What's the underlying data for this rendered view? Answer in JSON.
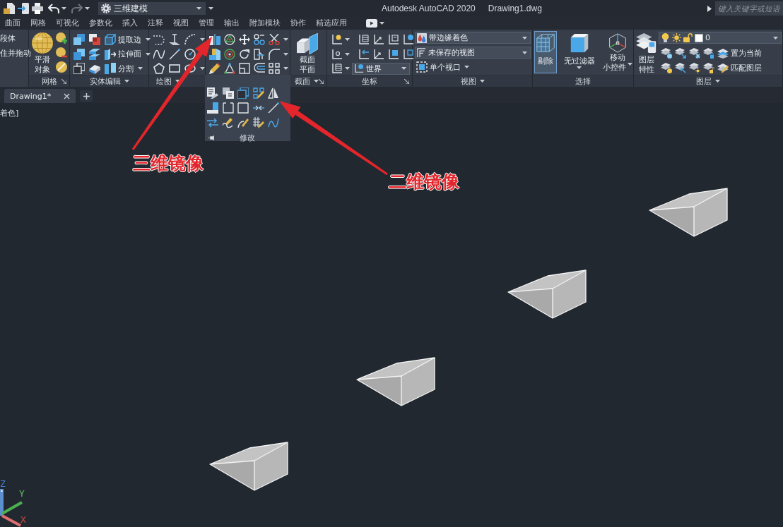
{
  "title_bar": {
    "quick_access": {
      "undo": {
        "disabled": false
      },
      "redo": {
        "disabled": true
      }
    },
    "workspace": "三维建模",
    "app_name": "Autodesk AutoCAD 2020",
    "file_name": "Drawing1.dwg",
    "search": {
      "placeholder": "键入关键字或短语"
    }
  },
  "ribbon_tabs": [
    {
      "label": "曲面",
      "selected": false
    },
    {
      "label": "网格",
      "selected": false
    },
    {
      "label": "可视化",
      "selected": false
    },
    {
      "label": "参数化",
      "selected": false
    },
    {
      "label": "插入",
      "selected": false
    },
    {
      "label": "注释",
      "selected": false
    },
    {
      "label": "视图",
      "selected": false
    },
    {
      "label": "管理",
      "selected": false
    },
    {
      "label": "输出",
      "selected": false
    },
    {
      "label": "附加模块",
      "selected": false
    },
    {
      "label": "协作",
      "selected": false
    },
    {
      "label": "精选应用",
      "selected": false
    }
  ],
  "ribbon_panels": [
    {
      "kind": "cut",
      "buttons": [
        "段体",
        "住并拖动"
      ]
    },
    {
      "kind": "mesh",
      "title": "网格",
      "menu": false,
      "launcher": true,
      "big_button": [
        "平滑",
        "对象"
      ]
    },
    {
      "kind": "solid_edit",
      "title": "实体编辑",
      "menu": true,
      "launcher": false,
      "tools": [
        "提取边",
        "拉伸面",
        "分割"
      ]
    },
    {
      "kind": "draw",
      "title": "绘图",
      "menu": true,
      "launcher": false
    },
    {
      "kind": "modify",
      "title": "修改",
      "expanded": true
    },
    {
      "kind": "section",
      "title": "截面",
      "menu": true,
      "launcher": true,
      "big_button": [
        "截面",
        "平面"
      ]
    },
    {
      "kind": "coordinates",
      "title": "坐标",
      "menu": false,
      "launcher": true,
      "ucs": "世界"
    },
    {
      "kind": "view",
      "title": "视图",
      "menu": true,
      "launcher": false,
      "visual_style": "带边缘着色",
      "named_view": "未保存的视图",
      "viewports": "单个视口"
    },
    {
      "kind": "selection",
      "title": "选择",
      "menu": false,
      "launcher": false,
      "buttons": [
        {
          "kind": "culling",
          "lines": [
            "剔除"
          ],
          "selected": true,
          "dropdown": false
        },
        {
          "kind": "filter",
          "lines": [
            "无过滤器"
          ],
          "selected": false,
          "dropdown": true
        },
        {
          "kind": "gizmo",
          "lines": [
            "移动",
            "小控件"
          ],
          "selected": false,
          "dropdown": true
        }
      ]
    },
    {
      "kind": "layers",
      "title": "图层",
      "menu": true,
      "launcher": false,
      "big_button": [
        "图层",
        "特性"
      ],
      "layer": "0",
      "actions": [
        "置为当前",
        "匹配图层"
      ]
    }
  ],
  "file_tabs": [
    {
      "label": "Drawing1*",
      "selected": true
    }
  ],
  "viewport": {
    "controls_label": "着色]",
    "solids": [
      {
        "kind": "wedge"
      },
      {
        "kind": "wedge"
      },
      {
        "kind": "wedge"
      },
      {
        "kind": "wedge"
      }
    ],
    "ucs_axes": {
      "x": "X",
      "y": "Y",
      "z": "Z"
    }
  },
  "annotations": [
    {
      "label": "三维镜像"
    },
    {
      "label": "二维镜像"
    }
  ]
}
